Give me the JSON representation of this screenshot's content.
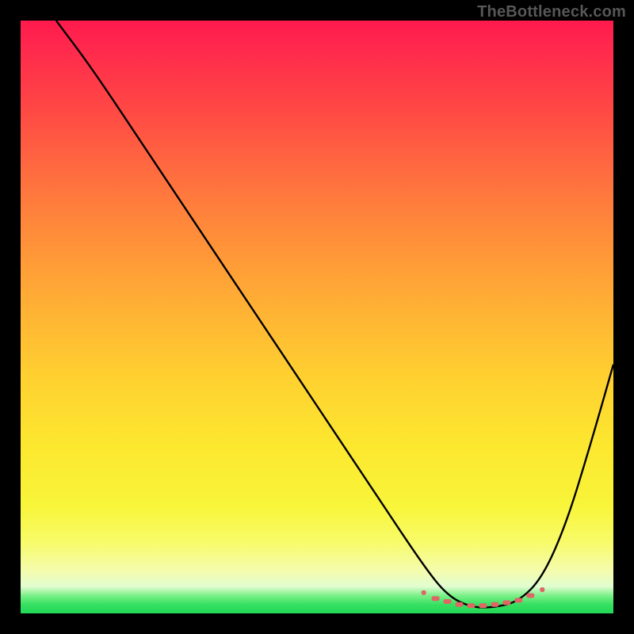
{
  "watermark": "TheBottleneck.com",
  "chart_data": {
    "type": "line",
    "title": "",
    "xlabel": "",
    "ylabel": "",
    "xlim": [
      0,
      100
    ],
    "ylim": [
      0,
      100
    ],
    "grid": false,
    "legend": false,
    "series": [
      {
        "name": "bottleneck-curve",
        "color": "#000000",
        "x": [
          6,
          12,
          20,
          30,
          40,
          50,
          60,
          68,
          72,
          76,
          80,
          84,
          88,
          92,
          96,
          100
        ],
        "y": [
          100,
          92,
          80,
          65,
          50,
          35,
          20,
          8,
          3,
          1,
          1,
          2,
          6,
          15,
          28,
          42
        ]
      },
      {
        "name": "optimal-range-marker",
        "color": "#e06666",
        "x": [
          68,
          70,
          72,
          74,
          76,
          78,
          80,
          82,
          84,
          86,
          88
        ],
        "y": [
          3.5,
          2.5,
          2.0,
          1.5,
          1.3,
          1.3,
          1.5,
          1.8,
          2.2,
          3.0,
          4.0
        ]
      }
    ]
  }
}
